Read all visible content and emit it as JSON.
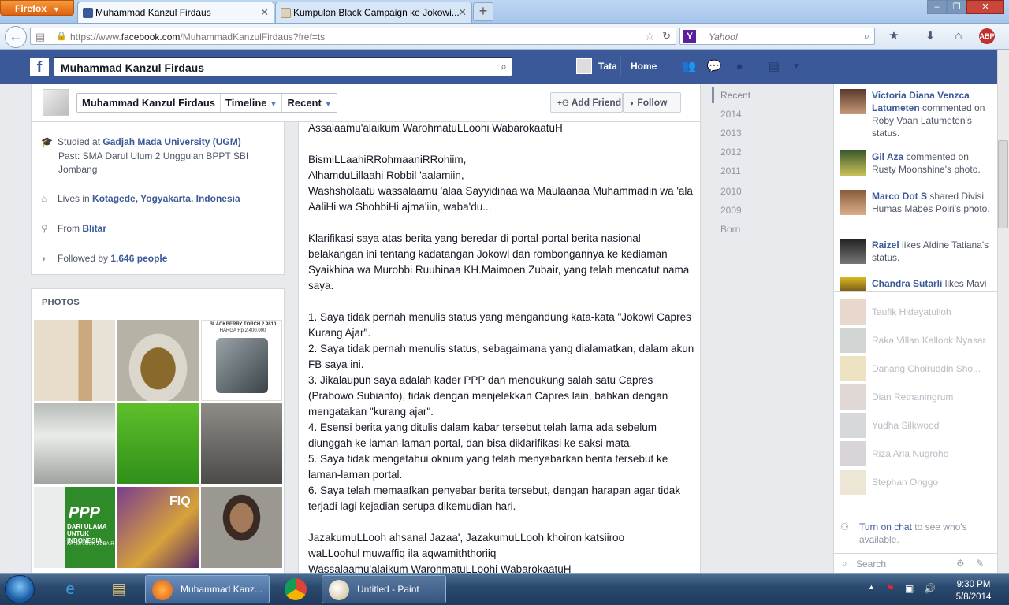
{
  "browser": {
    "menu_label": "Firefox",
    "tabs": [
      {
        "title": "Muhammad Kanzul Firdaus",
        "active": true
      },
      {
        "title": "Kumpulan Black Campaign ke Jokowi...",
        "active": false
      }
    ],
    "new_tab_label": "+",
    "url_prefix": "https://www.",
    "url_domain": "facebook.com",
    "url_path": "/MuhammadKanzulFirdaus?fref=ts",
    "search_placeholder": "Yahoo!",
    "window_buttons": [
      "–",
      "❐",
      "✕"
    ]
  },
  "facebook": {
    "logo": "f",
    "search_value": "Muhammad Kanzul Firdaus",
    "user_name": "Tata",
    "home_label": "Home",
    "header": {
      "profile_name": "Muhammad Kanzul Firdaus",
      "timeline_label": "Timeline",
      "recent_label": "Recent",
      "add_friend_label": "Add Friend",
      "follow_label": "Follow"
    },
    "about": {
      "studied_prefix": "Studied at",
      "studied_school": "Gadjah Mada University (UGM)",
      "past_school": "Past: SMA Darul Ulum 2 Unggulan BPPT SBI Jombang",
      "lives_prefix": "Lives in",
      "lives_place": "Kotagede, Yogyakarta, Indonesia",
      "from_prefix": "From",
      "from_place": "Blitar",
      "followed_prefix": "Followed by",
      "followed_count": "1,646 people"
    },
    "photos_title": "PHOTOS",
    "photo_labels": {
      "bb_title": "BLACKBERRY TORCH 2 9810",
      "bb_price": "HARGA Rp.2.400.000",
      "ppp_title": "PPP",
      "ppp_sub": "DARI ULAMA UNTUK INDONESIA",
      "ppp_name": "KH. MAIMUN ZUBAIR",
      "book_title": "FIQ"
    },
    "post_text": "Assalaamu'alaikum WarohmatuLLoohi WabarokaatuH\n\nBismiLLaahiRRohmaaniRRohiim,\nAlhamduLillaahi Robbil 'aalamiin,\nWashsholaatu wassalaamu 'alaa Sayyidinaa wa Maulaanaa Muhammadin wa 'ala AaliHi wa ShohbiHi ajma'iin, waba'du...\n\nKlarifikasi saya atas berita yang beredar di portal-portal berita nasional belakangan ini tentang kadatangan Jokowi dan rombongannya ke kediaman Syaikhina wa Murobbi Ruuhinaa KH.Maimoen Zubair, yang telah mencatut nama saya.\n\n1. Saya tidak pernah menulis status yang mengandung kata-kata \"Jokowi Capres Kurang Ajar\".\n2. Saya tidak pernah menulis status, sebagaimana yang dialamatkan, dalam akun FB saya ini.\n3. Jikalaupun saya adalah kader PPP dan mendukung salah satu Capres (Prabowo Subianto), tidak dengan menjelekkan Capres lain, bahkan dengan mengatakan \"kurang ajar\".\n4. Esensi berita yang ditulis dalam kabar tersebut telah lama ada sebelum diunggah ke laman-laman portal, dan bisa diklarifikasi ke saksi mata.\n5. Saya tidak mengetahui oknum yang telah menyebarkan berita tersebut ke laman-laman portal.\n6. Saya telah memaafkan penyebar berita tersebut, dengan harapan agar tidak terjadi lagi kejadian serupa dikemudian hari.\n\nJazakumuLLooh ahsanal Jazaa', JazakumuLLooh khoiron katsiiroo\nwaLLoohul muwaffiq ila aqwamiththoriiq\nWassalaamu'alaikum WarohmatuLLoohi WabarokaatuH",
    "years": [
      "Recent",
      "2014",
      "2013",
      "2012",
      "2011",
      "2010",
      "2009",
      "Born"
    ],
    "ticker": [
      {
        "name": "Victoria Diana Venzca Latumeten",
        "action": "commented on Roby Vaan Latumeten's status."
      },
      {
        "name": "Gil Aza",
        "action": "commented on Rusty Moonshine's photo."
      },
      {
        "name": "Marco Dot S",
        "action": "shared Divisi Humas Mabes Polri's photo."
      },
      {
        "name": "Raizel",
        "action": "likes Aldine Tatiana's status."
      },
      {
        "name": "Chandra Sutarli",
        "action": "likes Mavi"
      }
    ],
    "chat_friends": [
      "Taufik Hidayatulloh",
      "Raka Villan Kallonk Nyasar",
      "Danang Choiruddin Sho...",
      "Dian Retnaningrum",
      "Yudha Silkwood",
      "Riza Aria Nugroho",
      "Stephan Onggo"
    ],
    "turn_on_link": "Turn on chat",
    "turn_on_rest": "to see who's available.",
    "chat_search_placeholder": "Search"
  },
  "taskbar": {
    "firefox_task": "Muhammad Kanz...",
    "paint_task": "Untitled - Paint",
    "time": "9:30 PM",
    "date": "5/8/2014"
  },
  "colors": {
    "facebook_blue": "#3b5998",
    "link": "#3b5998",
    "firefox_orange": "#e8761f"
  }
}
